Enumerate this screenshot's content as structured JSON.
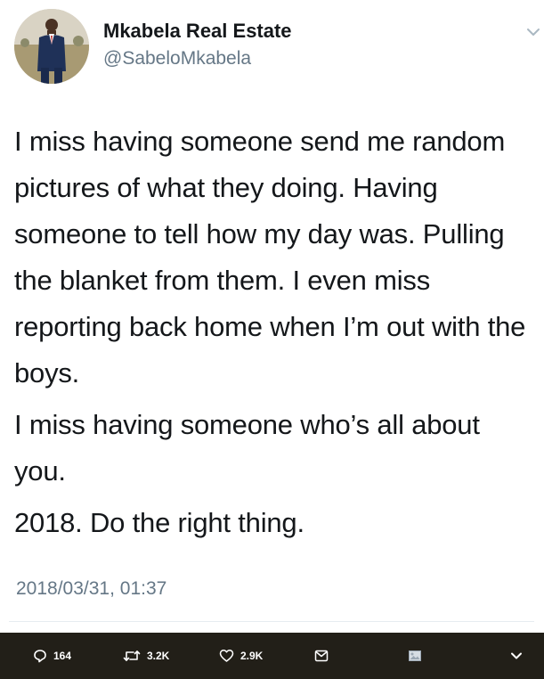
{
  "user": {
    "display_name": "Mkabela Real Estate",
    "handle": "@SabeloMkabela",
    "avatar_icon": "profile-photo"
  },
  "tweet": {
    "paragraphs": [
      "I miss having someone send me random pictures of what they doing. Having someone to tell how my day was. Pulling the blanket from them. I even miss reporting back home when I’m out with the boys.",
      "I miss having someone who’s all about you.",
      "2018. Do the right thing."
    ],
    "timestamp": "2018/03/31, 01:37"
  },
  "actions": {
    "reply": {
      "icon": "reply-icon",
      "count": "164"
    },
    "retweet": {
      "icon": "retweet-icon",
      "count": "3.2K"
    },
    "like": {
      "icon": "heart-icon",
      "count": "2.9K"
    },
    "message": {
      "icon": "envelope-icon"
    },
    "media": {
      "icon": "image-icon"
    },
    "more": {
      "icon": "chevron-down-icon"
    }
  },
  "colors": {
    "text": "#14171a",
    "secondary_text": "#657786",
    "action_bar_bg": "#221f18",
    "action_bar_fg": "#ffffff"
  }
}
